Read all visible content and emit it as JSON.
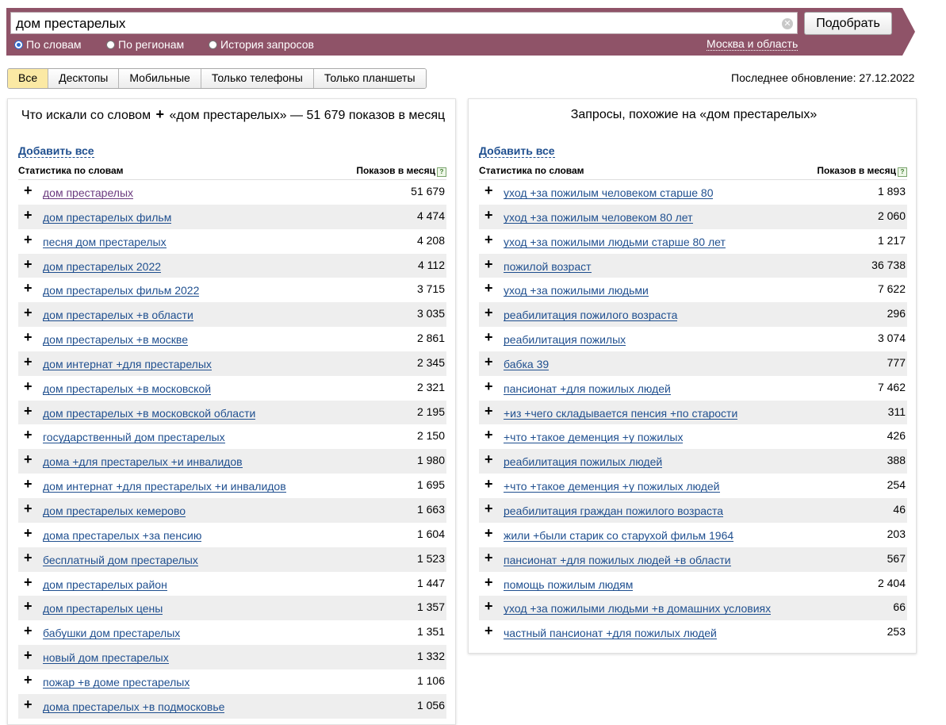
{
  "search": {
    "query": "дом престарелых",
    "button_label": "Подобрать",
    "clear_glyph": "✕",
    "modes": [
      {
        "label": "По словам",
        "checked": true
      },
      {
        "label": "По регионам",
        "checked": false
      },
      {
        "label": "История запросов",
        "checked": false
      }
    ],
    "region": "Москва и область"
  },
  "tabs": [
    {
      "label": "Все",
      "active": true
    },
    {
      "label": "Десктопы",
      "active": false
    },
    {
      "label": "Мобильные",
      "active": false
    },
    {
      "label": "Только телефоны",
      "active": false
    },
    {
      "label": "Только планшеты",
      "active": false
    }
  ],
  "last_update": "Последнее обновление: 27.12.2022",
  "left_panel": {
    "title_before": "Что искали со словом",
    "title_plus": "+",
    "title_after": "«дом престарелых» — 51 679 показов в месяц",
    "add_all": "Добавить все",
    "col_words": "Статистика по словам",
    "col_counts": "Показов в месяц",
    "help_glyph": "?",
    "plus_glyph": "+",
    "rows": [
      {
        "phrase": "дом престарелых",
        "count": "51 679"
      },
      {
        "phrase": "дом престарелых фильм",
        "count": "4 474"
      },
      {
        "phrase": "песня дом престарелых",
        "count": "4 208"
      },
      {
        "phrase": "дом престарелых 2022",
        "count": "4 112"
      },
      {
        "phrase": "дом престарелых фильм 2022",
        "count": "3 715"
      },
      {
        "phrase": "дом престарелых +в области",
        "count": "3 035"
      },
      {
        "phrase": "дом престарелых +в москве",
        "count": "2 861"
      },
      {
        "phrase": "дом интернат +для престарелых",
        "count": "2 345"
      },
      {
        "phrase": "дом престарелых +в московской",
        "count": "2 321"
      },
      {
        "phrase": "дом престарелых +в московской области",
        "count": "2 195"
      },
      {
        "phrase": "государственный дом престарелых",
        "count": "2 150"
      },
      {
        "phrase": "дома +для престарелых +и инвалидов",
        "count": "1 980"
      },
      {
        "phrase": "дом интернат +для престарелых +и инвалидов",
        "count": "1 695"
      },
      {
        "phrase": "дом престарелых кемерово",
        "count": "1 663"
      },
      {
        "phrase": "дома престарелых +за пенсию",
        "count": "1 604"
      },
      {
        "phrase": "бесплатный дом престарелых",
        "count": "1 523"
      },
      {
        "phrase": "дом престарелых район",
        "count": "1 447"
      },
      {
        "phrase": "дом престарелых цены",
        "count": "1 357"
      },
      {
        "phrase": "бабушки дом престарелых",
        "count": "1 351"
      },
      {
        "phrase": "новый дом престарелых",
        "count": "1 332"
      },
      {
        "phrase": "пожар +в доме престарелых",
        "count": "1 106"
      },
      {
        "phrase": "дома престарелых +в подмосковье",
        "count": "1 056"
      }
    ]
  },
  "right_panel": {
    "title": "Запросы, похожие на «дом престарелых»",
    "add_all": "Добавить все",
    "col_words": "Статистика по словам",
    "col_counts": "Показов в месяц",
    "help_glyph": "?",
    "plus_glyph": "+",
    "rows": [
      {
        "phrase": "уход +за пожилым человеком старше 80",
        "count": "1 893"
      },
      {
        "phrase": "уход +за пожилым человеком 80 лет",
        "count": "2 060"
      },
      {
        "phrase": "уход +за пожилыми людьми старше 80 лет",
        "count": "1 217"
      },
      {
        "phrase": "пожилой возраст",
        "count": "36 738"
      },
      {
        "phrase": "уход +за пожилыми людьми",
        "count": "7 622"
      },
      {
        "phrase": "реабилитация пожилого возраста",
        "count": "296"
      },
      {
        "phrase": "реабилитация пожилых",
        "count": "3 074"
      },
      {
        "phrase": "бабка 39",
        "count": "777"
      },
      {
        "phrase": "пансионат +для пожилых людей",
        "count": "7 462"
      },
      {
        "phrase": "+из +чего складывается пенсия +по старости",
        "count": "311"
      },
      {
        "phrase": "+что +такое деменция +у пожилых",
        "count": "426"
      },
      {
        "phrase": "реабилитация пожилых людей",
        "count": "388"
      },
      {
        "phrase": "+что +такое деменция +у пожилых людей",
        "count": "254"
      },
      {
        "phrase": "реабилитация граждан пожилого возраста",
        "count": "46"
      },
      {
        "phrase": "жили +были старик со старухой фильм 1964",
        "count": "203"
      },
      {
        "phrase": "пансионат +для пожилых людей +в области",
        "count": "567"
      },
      {
        "phrase": "помощь пожилым людям",
        "count": "2 404"
      },
      {
        "phrase": "уход +за пожилыми людьми +в домашних условиях",
        "count": "66"
      },
      {
        "phrase": "частный пансионат +для пожилых людей",
        "count": "253"
      }
    ]
  }
}
